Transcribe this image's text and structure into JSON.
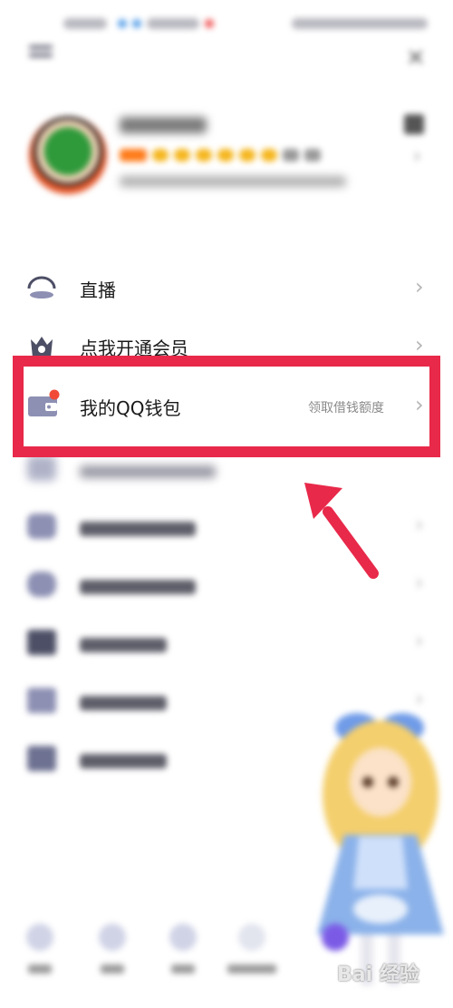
{
  "colors": {
    "highlight": "#e8294a",
    "arrow": "#e8294a",
    "wallet_dot": "#f14b37",
    "icon_tint": "#8d90b3"
  },
  "header": {
    "menu_icon": "menu-icon",
    "close_icon": "close-icon"
  },
  "profile": {
    "avatar_icon": "avatar",
    "qr_icon": "qr-code-icon"
  },
  "menu": {
    "items": [
      {
        "icon": "live-icon",
        "label": "直播"
      },
      {
        "icon": "vip-crown-icon",
        "label": "点我开通会员"
      },
      {
        "icon": "wallet-icon",
        "label": "我的QQ钱包",
        "sub": "领取借钱额度",
        "highlighted": true
      }
    ]
  },
  "watermark": {
    "text": "Bai 经验"
  }
}
